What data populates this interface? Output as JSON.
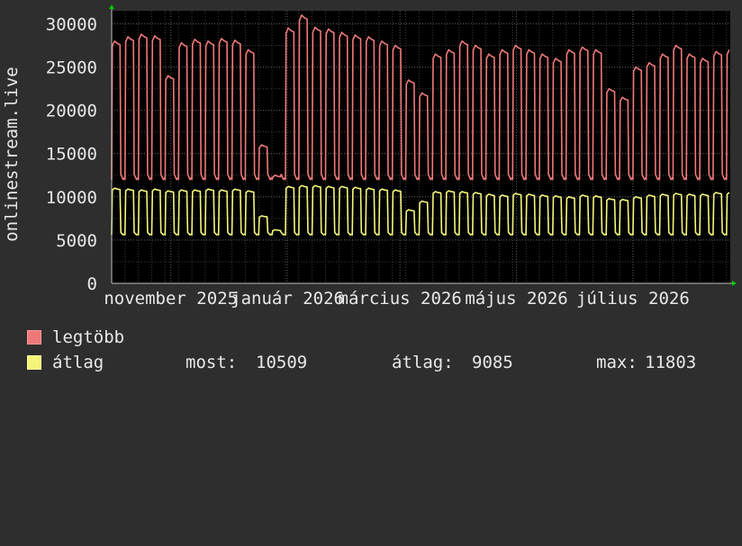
{
  "colors": {
    "background": "#2e2e2e",
    "plot_background": "#000000",
    "grid": "#5a5a5a",
    "grid_minor": "#3a3a3a",
    "axis": "#bfbfbf",
    "text": "#e8e8e8",
    "max_series": "#f07878",
    "avg_series": "#f5f57a",
    "arrow": "#00cc00"
  },
  "chart_data": {
    "type": "line",
    "ylabel": "onlinestream.live",
    "y_ticks": [
      "0",
      "5000",
      "10000",
      "15000",
      "20000",
      "25000",
      "30000"
    ],
    "y_tick_values": [
      0,
      5000,
      10000,
      15000,
      20000,
      25000,
      30000
    ],
    "ylim": [
      0,
      31500
    ],
    "x_tick_labels": [
      "november 2025",
      "január 2026",
      "március 2026",
      "május 2026",
      "július 2026"
    ],
    "x_tick_dates": [
      "2025-11-01",
      "2026-01-01",
      "2026-03-01",
      "2026-05-01",
      "2026-07-01"
    ],
    "xlim": [
      "2025-10-01",
      "2026-08-21"
    ],
    "grid": true,
    "legend_placement": "bottom",
    "series": [
      {
        "name": "legtöbb",
        "pattern": "weekly",
        "start": "2025-10-01",
        "weekday_high": 27500,
        "weekend_low": 12000,
        "weekly_highs": [
          28000,
          28500,
          28800,
          28600,
          24000,
          27800,
          28200,
          28000,
          28300,
          28100,
          27000,
          16000,
          12500,
          29500,
          31000,
          29600,
          29400,
          29000,
          28700,
          28500,
          28000,
          27500,
          23500,
          22000,
          26500,
          27000,
          28000,
          27500,
          26500,
          27000,
          27500,
          27000,
          26500,
          26000,
          27000,
          27300,
          27000,
          22500,
          21500,
          25000,
          25500,
          26500,
          27500,
          26500,
          26000,
          26800,
          27000
        ]
      },
      {
        "name": "átlag",
        "pattern": "weekly",
        "start": "2025-10-01",
        "weekday_high": 10800,
        "weekend_low": 5600,
        "weekly_highs": [
          11000,
          10900,
          10800,
          10900,
          10700,
          10800,
          10800,
          10900,
          10800,
          10900,
          10700,
          7800,
          6200,
          11200,
          11300,
          11300,
          11200,
          11200,
          11100,
          11000,
          10900,
          10800,
          8500,
          9500,
          10600,
          10700,
          10600,
          10500,
          10300,
          10200,
          10400,
          10300,
          10200,
          10100,
          10000,
          10200,
          10100,
          9800,
          9700,
          10000,
          10200,
          10300,
          10400,
          10300,
          10300,
          10500,
          10500
        ]
      }
    ]
  },
  "legend": {
    "max_label": "legtöbb",
    "avg_label": "átlag",
    "now_label": "most:",
    "now_value": "10509",
    "avg_stat_label": "átlag:",
    "avg_stat_value": "9085",
    "max_stat_label": "max:",
    "max_stat_value": "11803"
  }
}
